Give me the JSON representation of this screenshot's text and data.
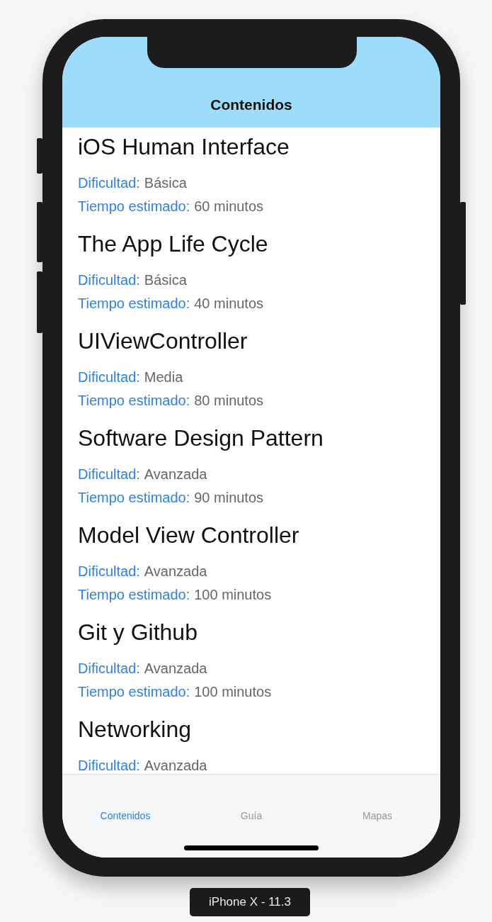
{
  "nav_bar": {
    "title": "Contenidos"
  },
  "courses": [
    {
      "title": "iOS Human Interface",
      "difficulty_label": "Dificultad:",
      "difficulty": "Básica",
      "time_label": "Tiempo estimado:",
      "time": "60 minutos"
    },
    {
      "title": "The App Life Cycle",
      "difficulty_label": "Dificultad:",
      "difficulty": "Básica",
      "time_label": "Tiempo estimado:",
      "time": "40 minutos"
    },
    {
      "title": "UIViewController",
      "difficulty_label": "Dificultad:",
      "difficulty": "Media",
      "time_label": "Tiempo estimado:",
      "time": "80 minutos"
    },
    {
      "title": "Software Design Pattern",
      "difficulty_label": "Dificultad:",
      "difficulty": "Avanzada",
      "time_label": "Tiempo estimado:",
      "time": "90 minutos"
    },
    {
      "title": "Model View Controller",
      "difficulty_label": "Dificultad:",
      "difficulty": "Avanzada",
      "time_label": "Tiempo estimado:",
      "time": "100 minutos"
    },
    {
      "title": "Git y Github",
      "difficulty_label": "Dificultad:",
      "difficulty": "Avanzada",
      "time_label": "Tiempo estimado:",
      "time": "100 minutos"
    },
    {
      "title": "Networking",
      "difficulty_label": "Dificultad:",
      "difficulty": "Avanzada"
    }
  ],
  "tab_bar": [
    {
      "label": "Contenidos",
      "selected": true
    },
    {
      "label": "Guía",
      "selected": false
    },
    {
      "label": "Mapas",
      "selected": false
    }
  ],
  "device_label": "iPhone X - 11.3"
}
